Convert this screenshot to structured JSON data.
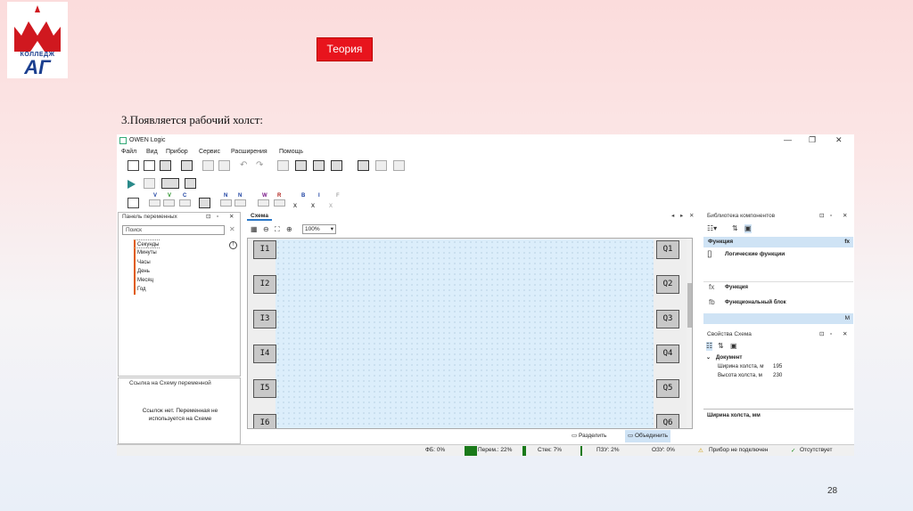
{
  "slide": {
    "logo_text_top": "КОЛЛЕДЖ",
    "logo_text_bottom": "АГ",
    "theory_button": "Теория",
    "caption": "3.Появляется рабочий холст:",
    "page_number": "28"
  },
  "app": {
    "title": "OWEN Logic",
    "window_controls": [
      "—",
      "❐",
      "✕"
    ],
    "menu": [
      "Файл",
      "Вид",
      "Прибор",
      "Сервис",
      "Расширения",
      "Помощь"
    ],
    "toolbar3_labels": [
      "V",
      "V",
      "C",
      "N",
      "N",
      "W",
      "R",
      "B",
      "I",
      "F"
    ],
    "variables_panel": {
      "title": "Панель переменных",
      "search_placeholder": "Поиск",
      "items": [
        "Секунды",
        "Минуты",
        "Часы",
        "День",
        "Месяц",
        "Год"
      ]
    },
    "reference_panel": {
      "title": "Ссылка на Схему переменной",
      "message": "Ссылок нет. Переменная не используется на Схеме"
    },
    "schema": {
      "tab": "Схема",
      "zoom": "100%",
      "inputs": [
        "I1",
        "I2",
        "I3",
        "I4",
        "I5",
        "I6"
      ],
      "outputs": [
        "Q1",
        "Q2",
        "Q3",
        "Q4",
        "Q5",
        "Q6"
      ],
      "split_label": "Разделить",
      "merge_label": "Объединить"
    },
    "library": {
      "title": "Библиотека компонентов",
      "section": "Функция",
      "section_badge": "fx",
      "logic_functions": "Логические функции",
      "func_icon": "fx",
      "func_label": "Функция",
      "fb_icon": "fb",
      "fb_label": "Функциональный блок",
      "m_badge": "M"
    },
    "properties": {
      "title": "Свойства Схема",
      "group": "Документ",
      "rows": [
        {
          "name": "Ширина холста, м",
          "value": "195"
        },
        {
          "name": "Высота холста, м",
          "value": "230"
        }
      ],
      "description": "Ширина холста, мм"
    },
    "status": {
      "fb": "ФБ: 0%",
      "vars": "Перем.: 22%",
      "stack": "Стек: 7%",
      "rom": "ПЗУ: 2%",
      "ram": "ОЗУ: 0%",
      "device": "Прибор не подключен",
      "missing": "Отсутствует"
    }
  }
}
